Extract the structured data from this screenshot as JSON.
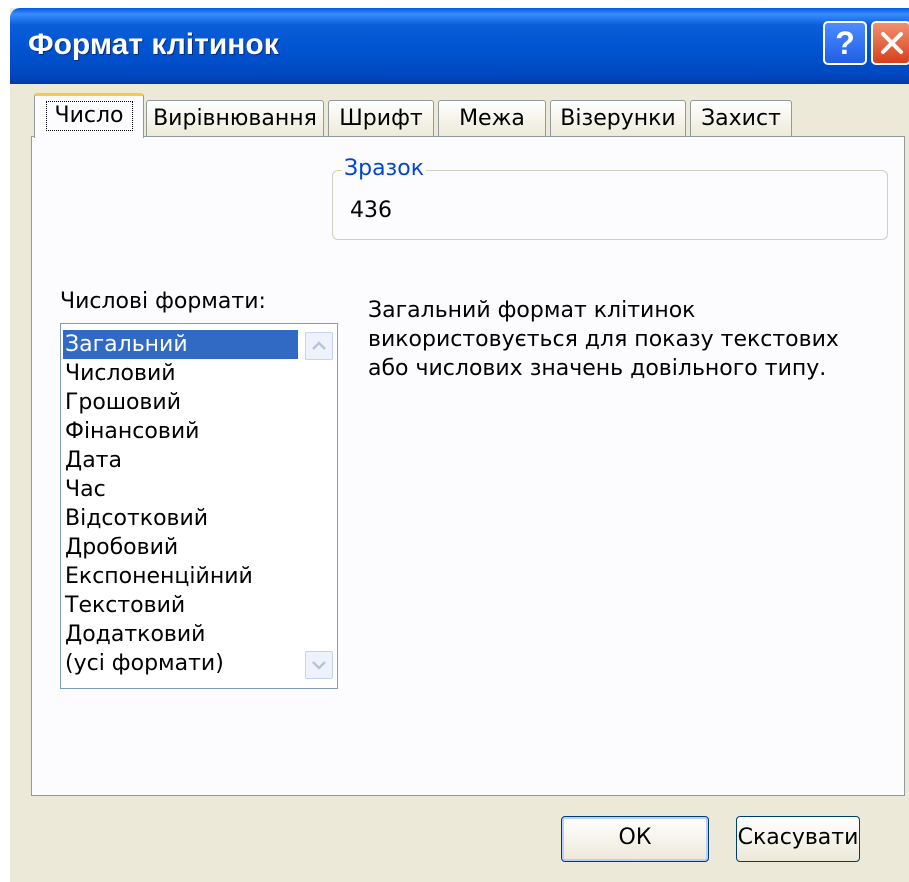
{
  "dialog": {
    "title": "Формат клітинок"
  },
  "titlebar": {
    "help_label": "?"
  },
  "tabs": [
    {
      "label": "Число"
    },
    {
      "label": "Вирівнювання"
    },
    {
      "label": "Шрифт"
    },
    {
      "label": "Межа"
    },
    {
      "label": "Візерунки"
    },
    {
      "label": "Захист"
    }
  ],
  "number_tab": {
    "formats_label": "Числові формати:",
    "formats": [
      "Загальний",
      "Числовий",
      "Грошовий",
      "Фінансовий",
      "Дата",
      "Час",
      "Відсотковий",
      "Дробовий",
      "Експоненційний",
      "Текстовий",
      "Додатковий",
      "(усі формати)"
    ],
    "selected_format": "Загальний",
    "sample_title": "Зразок",
    "sample_value": "436",
    "description_lines": [
      "Загальний формат клітинок",
      "використовується для показу текстових",
      "або числових значень довільного типу."
    ]
  },
  "buttons": {
    "ok": "ОК",
    "cancel": "Скасувати"
  },
  "colors": {
    "titlebar": "#0053d0",
    "selection": "#316ac5",
    "active_tab_accent": "#ffc83c",
    "group_title": "#0046d5"
  }
}
